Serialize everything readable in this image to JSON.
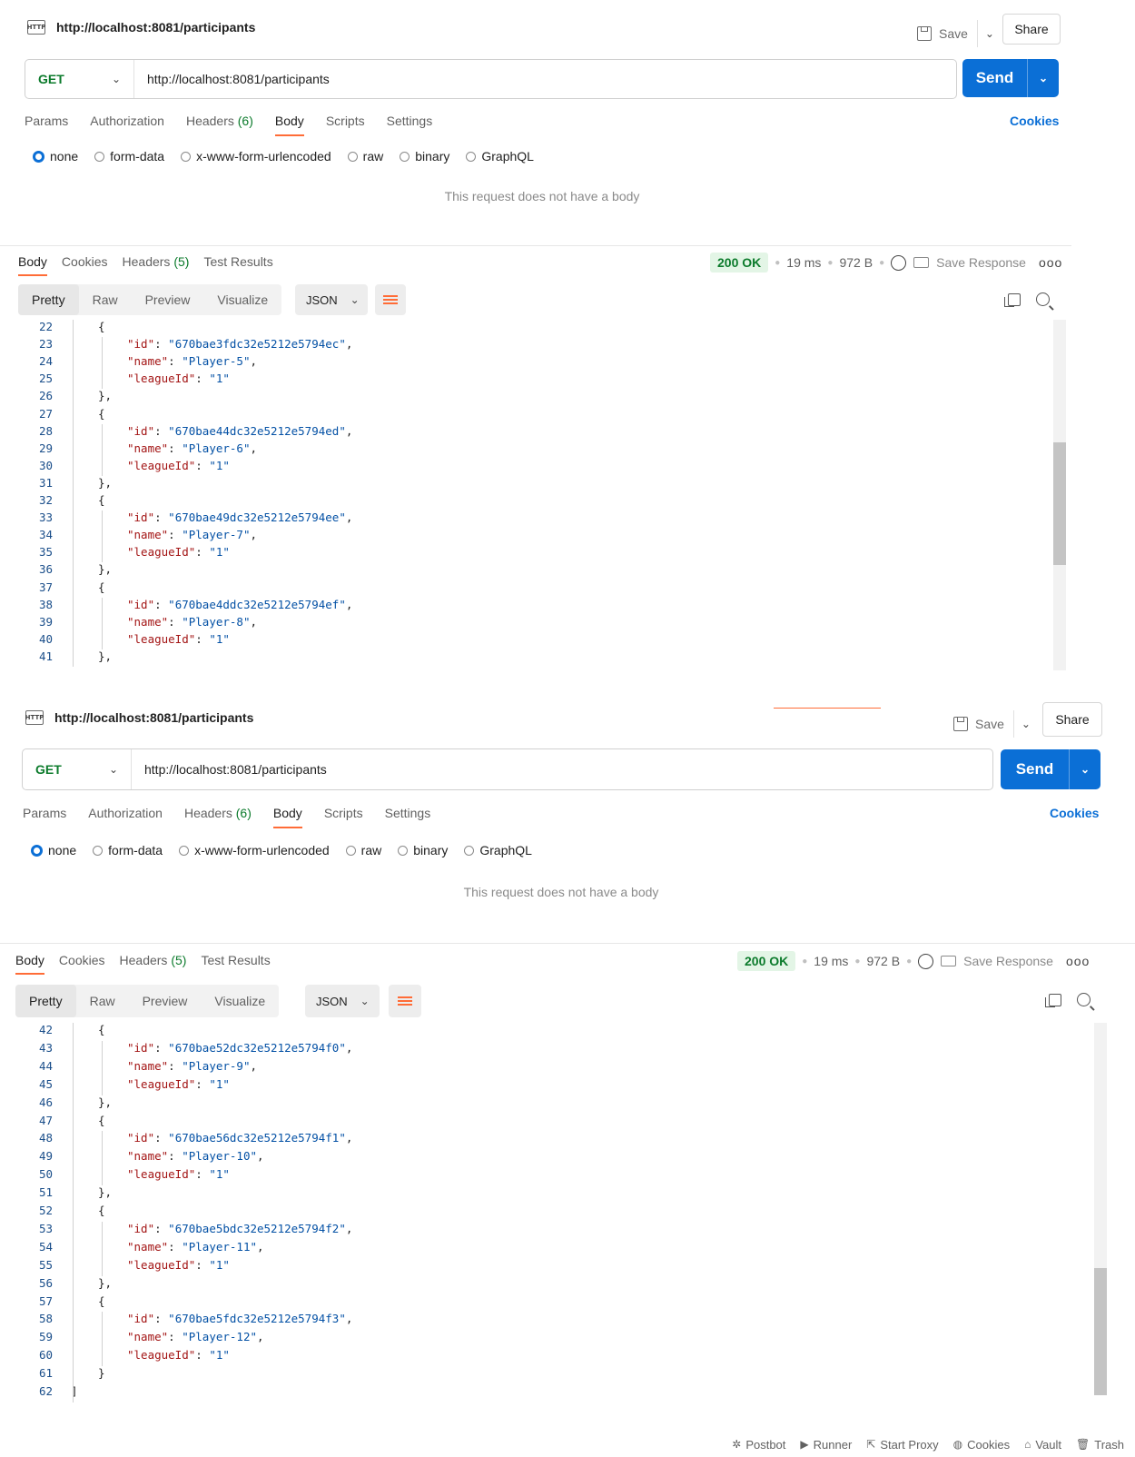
{
  "request": {
    "url_title": "http://localhost:8081/participants",
    "save_label": "Save",
    "share_label": "Share",
    "method": "GET",
    "url": "http://localhost:8081/participants",
    "send_label": "Send",
    "tabs": [
      "Params",
      "Authorization",
      "Headers",
      "Body",
      "Scripts",
      "Settings"
    ],
    "headers_count": "(6)",
    "active_tab": "Body",
    "cookies_label": "Cookies",
    "body_types": [
      "none",
      "form-data",
      "x-www-form-urlencoded",
      "raw",
      "binary",
      "GraphQL"
    ],
    "selected_body_type": "none",
    "no_body_text": "This request does not have a body",
    "http_icon_text": "HTTP"
  },
  "response": {
    "tabs": [
      "Body",
      "Cookies",
      "Headers",
      "Test Results"
    ],
    "headers_count": "(5)",
    "status": "200 OK",
    "time": "19 ms",
    "size": "972 B",
    "save_response_label": "Save Response",
    "more": "ooo",
    "view_modes": [
      "Pretty",
      "Raw",
      "Preview",
      "Visualize"
    ],
    "active_view": "Pretty",
    "format": "JSON"
  },
  "pane1_lines": [
    {
      "n": "22",
      "t": "{"
    },
    {
      "n": "23",
      "t": "\"id\": \"670bae3fdc32e5212e5794ec\","
    },
    {
      "n": "24",
      "t": "\"name\": \"Player-5\","
    },
    {
      "n": "25",
      "t": "\"leagueId\": \"1\""
    },
    {
      "n": "26",
      "t": "},"
    },
    {
      "n": "27",
      "t": "{"
    },
    {
      "n": "28",
      "t": "\"id\": \"670bae44dc32e5212e5794ed\","
    },
    {
      "n": "29",
      "t": "\"name\": \"Player-6\","
    },
    {
      "n": "30",
      "t": "\"leagueId\": \"1\""
    },
    {
      "n": "31",
      "t": "},"
    },
    {
      "n": "32",
      "t": "{"
    },
    {
      "n": "33",
      "t": "\"id\": \"670bae49dc32e5212e5794ee\","
    },
    {
      "n": "34",
      "t": "\"name\": \"Player-7\","
    },
    {
      "n": "35",
      "t": "\"leagueId\": \"1\""
    },
    {
      "n": "36",
      "t": "},"
    },
    {
      "n": "37",
      "t": "{"
    },
    {
      "n": "38",
      "t": "\"id\": \"670bae4ddc32e5212e5794ef\","
    },
    {
      "n": "39",
      "t": "\"name\": \"Player-8\","
    },
    {
      "n": "40",
      "t": "\"leagueId\": \"1\""
    },
    {
      "n": "41",
      "t": "},"
    }
  ],
  "pane2_lines": [
    {
      "n": "42",
      "t": "{"
    },
    {
      "n": "43",
      "t": "\"id\": \"670bae52dc32e5212e5794f0\","
    },
    {
      "n": "44",
      "t": "\"name\": \"Player-9\","
    },
    {
      "n": "45",
      "t": "\"leagueId\": \"1\""
    },
    {
      "n": "46",
      "t": "},"
    },
    {
      "n": "47",
      "t": "{"
    },
    {
      "n": "48",
      "t": "\"id\": \"670bae56dc32e5212e5794f1\","
    },
    {
      "n": "49",
      "t": "\"name\": \"Player-10\","
    },
    {
      "n": "50",
      "t": "\"leagueId\": \"1\""
    },
    {
      "n": "51",
      "t": "},"
    },
    {
      "n": "52",
      "t": "{"
    },
    {
      "n": "53",
      "t": "\"id\": \"670bae5bdc32e5212e5794f2\","
    },
    {
      "n": "54",
      "t": "\"name\": \"Player-11\","
    },
    {
      "n": "55",
      "t": "\"leagueId\": \"1\""
    },
    {
      "n": "56",
      "t": "},"
    },
    {
      "n": "57",
      "t": "{"
    },
    {
      "n": "58",
      "t": "\"id\": \"670bae5fdc32e5212e5794f3\","
    },
    {
      "n": "59",
      "t": "\"name\": \"Player-12\","
    },
    {
      "n": "60",
      "t": "\"leagueId\": \"1\""
    },
    {
      "n": "61",
      "t": "}"
    },
    {
      "n": "62",
      "t": "]"
    }
  ],
  "footer": [
    {
      "icon": "postbot-icon",
      "glyph": "✲",
      "label": "Postbot"
    },
    {
      "icon": "runner-icon",
      "glyph": "▶",
      "label": "Runner"
    },
    {
      "icon": "proxy-icon",
      "glyph": "⇱",
      "label": "Start Proxy"
    },
    {
      "icon": "cookie-icon",
      "glyph": "◍",
      "label": "Cookies"
    },
    {
      "icon": "vault-icon",
      "glyph": "⌂",
      "label": "Vault"
    },
    {
      "icon": "trash-icon",
      "glyph": "🗑",
      "label": "Trash"
    }
  ],
  "colors": {
    "accent": "#ff6c37",
    "send": "#0b6fd6",
    "method": "#0c7b2c",
    "json_key": "#a31515",
    "json_string": "#0451a5"
  }
}
